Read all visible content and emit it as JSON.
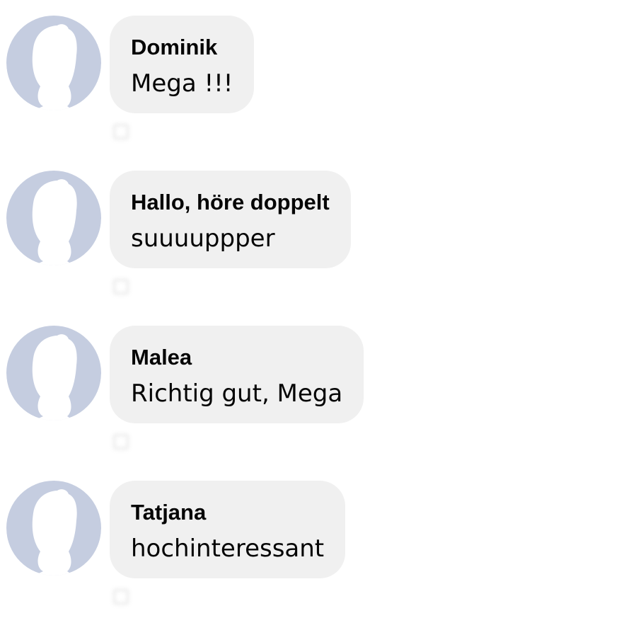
{
  "colors": {
    "bubble_bg": "#f0f0f0",
    "avatar_fill": "#c5cde0",
    "text": "#050505"
  },
  "avatar_icon": "default-profile-silhouette",
  "comments": [
    {
      "author": "Dominik",
      "text": "Mega !!!"
    },
    {
      "author": "Hallo, höre doppelt",
      "text": "suuuuppper"
    },
    {
      "author": "Malea",
      "text": "Richtig gut, Mega"
    },
    {
      "author": "Tatjana",
      "text": "hochinteressant"
    }
  ]
}
